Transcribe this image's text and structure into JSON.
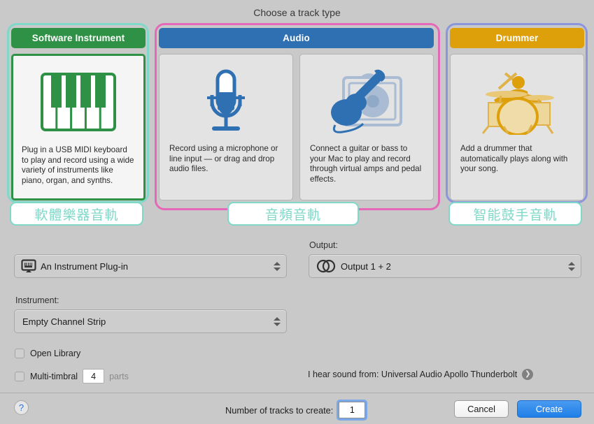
{
  "dialog": {
    "title": "Choose a track type"
  },
  "groups": [
    {
      "id": "software-instrument",
      "header": "Software Instrument",
      "header_color": "#2e9145",
      "annotation_color": "#7fd8c8",
      "annotation_label": "軟體樂器音軌",
      "cards": [
        {
          "icon": "piano-keyboard-icon",
          "description": "Plug in a USB MIDI keyboard to play and record using a wide variety of instruments like piano, organ, and synths.",
          "selected": true
        }
      ]
    },
    {
      "id": "audio",
      "header": "Audio",
      "header_color": "#2f70b3",
      "annotation_color": "#e668b8",
      "annotation_label": "音頻音軌",
      "cards": [
        {
          "icon": "microphone-icon",
          "description": "Record using a microphone or line input — or drag and drop audio files.",
          "selected": false
        },
        {
          "icon": "guitar-amp-icon",
          "description": "Connect a guitar or bass to your Mac to play and record through virtual amps and pedal effects.",
          "selected": false
        }
      ]
    },
    {
      "id": "drummer",
      "header": "Drummer",
      "header_color": "#dda00b",
      "annotation_color": "#8b96dd",
      "annotation_label": "智能鼓手音軌",
      "cards": [
        {
          "icon": "drummer-icon",
          "description": "Add a drummer that automatically plays along with your song.",
          "selected": false
        }
      ]
    }
  ],
  "settings": {
    "plugin": {
      "icon": "instrument-plugin-icon",
      "value": "An Instrument Plug-in"
    },
    "output": {
      "label": "Output:",
      "icon": "stereo-output-icon",
      "value": "Output 1 + 2"
    },
    "instrument": {
      "label": "Instrument:",
      "value": "Empty Channel Strip"
    },
    "open_library": {
      "label": "Open Library",
      "checked": false
    },
    "multi_timbral": {
      "label": "Multi-timbral",
      "checked": false,
      "parts_value": "4",
      "parts_label": "parts"
    },
    "hear_sound_from": {
      "label": "I hear sound from: Universal Audio Apollo Thunderbolt",
      "disclosure_icon": "chevron-right-icon"
    }
  },
  "footer": {
    "help_icon": "?",
    "tracks_label": "Number of tracks to create:",
    "tracks_value": "1",
    "cancel_label": "Cancel",
    "create_label": "Create"
  }
}
